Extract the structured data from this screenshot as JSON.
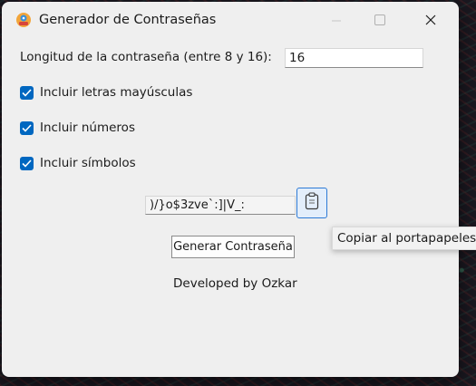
{
  "window": {
    "title": "Generador de Contraseñas"
  },
  "form": {
    "length_label": "Longitud de la contraseña (entre 8 y 16):",
    "length_value": "16",
    "options": [
      {
        "label": "Incluir letras mayúsculas",
        "checked": true
      },
      {
        "label": "Incluir números",
        "checked": true
      },
      {
        "label": "Incluir símbolos",
        "checked": true
      }
    ],
    "generated_password": ")/}o$3zve`:]|V_:",
    "generate_button_label": "Generar Contraseña",
    "copy_tooltip": "Copiar al portapapeles"
  },
  "footer": {
    "credit": "Developed by Ozkar"
  },
  "icons": {
    "app": "app-logo-icon",
    "minimize": "minimize-icon",
    "maximize": "maximize-icon",
    "close": "close-icon",
    "checkbox": "checkmark-icon",
    "copy": "clipboard-icon"
  },
  "colors": {
    "accent": "#0067c0",
    "window_bg": "#efefef"
  }
}
